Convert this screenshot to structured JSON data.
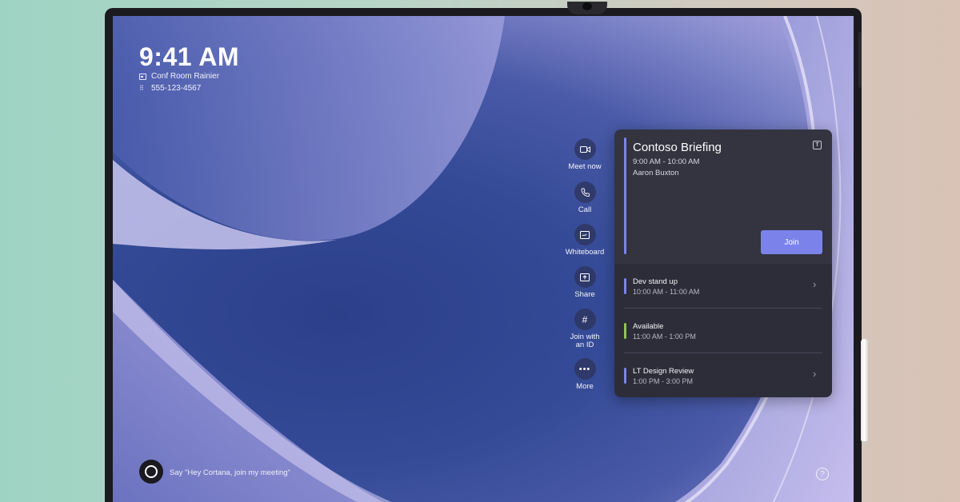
{
  "status": {
    "time": "9:41 AM",
    "room": "Conf Room Rainier",
    "phone": "555-123-4567"
  },
  "actions": [
    {
      "label": "Meet now",
      "icon": "video-camera-icon"
    },
    {
      "label": "Call",
      "icon": "phone-icon"
    },
    {
      "label": "Whiteboard",
      "icon": "whiteboard-icon"
    },
    {
      "label": "Share",
      "icon": "share-screen-icon"
    },
    {
      "label": "Join with an ID",
      "icon": "hash-icon"
    },
    {
      "label": "More",
      "icon": "more-icon"
    }
  ],
  "current_meeting": {
    "title": "Contoso Briefing",
    "time": "9:00 AM - 10:00 AM",
    "organizer": "Aaron Buxton",
    "join_label": "Join",
    "accent": "#7b83eb"
  },
  "upcoming": [
    {
      "title": "Dev stand up",
      "time": "10:00 AM - 11:00 AM",
      "accent": "#7b83eb"
    },
    {
      "title": "Available",
      "time": "11:00 AM - 1:00 PM",
      "accent": "#92c353"
    },
    {
      "title": "LT Design Review",
      "time": "1:00 PM - 3:00 PM",
      "accent": "#7b83eb"
    }
  ],
  "cortana": {
    "prompt": "Say \"Hey Cortana, join my meeting\""
  },
  "colors": {
    "join_button": "#7b83eb",
    "card_bg": "#2c2d38",
    "available": "#92c353"
  }
}
